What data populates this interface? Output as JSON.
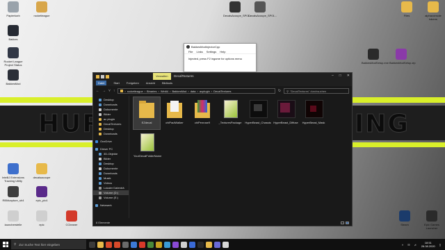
{
  "desktop": {
    "banner_left": "HURR",
    "banner_right": "DING",
    "icons": [
      {
        "id": "papierkorb",
        "label": "Papierkorb",
        "color": "#9aa3ab"
      },
      {
        "id": "rocketleague",
        "label": "rocketleague",
        "color": "#d8a64a"
      },
      {
        "id": "bakkes",
        "label": "Bakkes",
        "color": "#262a33"
      },
      {
        "id": "rl-tracker",
        "label": "Rocket League Project Status",
        "color": "#323846"
      },
      {
        "id": "bakkesmod",
        "label": "BakkesMod",
        "color": "#2b2f38"
      },
      {
        "id": "decal-1",
        "label": "DecalsAcoupe_SP01...",
        "color": "#333"
      },
      {
        "id": "decal-2",
        "label": "DecalsAcoupe_SP01...",
        "color": "#555"
      },
      {
        "id": "files",
        "label": "Files",
        "color": "#e7b94a"
      },
      {
        "id": "alphaconsole",
        "label": "alphaconsole tokens",
        "color": "#e7b94a"
      },
      {
        "id": "bakkesmodsetup",
        "label": "BakkesModSetup.exe",
        "color": "#2a2a2a"
      },
      {
        "id": "bakkesmodsetup-zip",
        "label": "BakkesModSetup.zip",
        "color": "#8a3aa8"
      },
      {
        "id": "intellij",
        "label": "IntelliJ Extensions Tracking Utility",
        "color": "#3d6fcc"
      },
      {
        "id": "decalsacoupe",
        "label": "decalsacoupe",
        "color": "#e7b94a"
      },
      {
        "id": "rl-unknown",
        "label": "RBMcapture_sh4",
        "color": "#3d3d3d"
      },
      {
        "id": "epic-x",
        "label": "epic_pic4",
        "color": "#5a2a8a"
      },
      {
        "id": "launcher",
        "label": "launcherstelle",
        "color": "#cfcfcf"
      },
      {
        "id": "epic",
        "label": "epic",
        "color": "#cfcfcf"
      },
      {
        "id": "ccleaner",
        "label": "CCleaner",
        "color": "#d33a2a"
      },
      {
        "id": "steam",
        "label": "Steam",
        "color": "#1b3b6b"
      },
      {
        "id": "epic-games",
        "label": "Epic Games Launcher",
        "color": "#2a2a2a"
      }
    ]
  },
  "dialog": {
    "title": "BakkesModInjectorCpp",
    "menu": [
      "File",
      "Links",
      "Settings",
      "Help"
    ],
    "message": "Injected, press F2 ingame for options menu"
  },
  "explorer": {
    "context_tab": "Verwalten",
    "window_title": "DecalTextures",
    "ribbon_tabs": [
      "Datei",
      "Start",
      "Freigeben",
      "Ansicht",
      "Bildtools"
    ],
    "breadcrumb": [
      "rocketleague",
      "Binaries",
      "Win64",
      "BakkesMod",
      "data",
      "acplugin",
      "DecalTextures"
    ],
    "search_placeholder": "\"DecalTextures\" durchsuchen",
    "nav": [
      {
        "label": "Desktop",
        "color": "#5b9bd5",
        "selected": false,
        "indent": 1
      },
      {
        "label": "Downloads",
        "color": "#5b9bd5",
        "selected": false,
        "indent": 1
      },
      {
        "label": "Dokumente",
        "color": "#cfcfcf",
        "selected": false,
        "indent": 1
      },
      {
        "label": "Bilder",
        "color": "#cfcfcf",
        "selected": false,
        "indent": 1
      },
      {
        "label": "ac plugin",
        "color": "#e7b94a",
        "selected": false,
        "indent": 1
      },
      {
        "label": "DecalTextures",
        "color": "#e7b94a",
        "selected": false,
        "indent": 1
      },
      {
        "label": "Desktop",
        "color": "#e7b94a",
        "selected": false,
        "indent": 1
      },
      {
        "label": "Downloads",
        "color": "#e7b94a",
        "selected": false,
        "indent": 1
      },
      {
        "label": "",
        "color": "",
        "gap": true
      },
      {
        "label": "OneDrive",
        "color": "#3d8be0",
        "selected": false,
        "indent": 0
      },
      {
        "label": "",
        "color": "",
        "gap": true
      },
      {
        "label": "Dieser PC",
        "color": "#5b9bd5",
        "selected": false,
        "indent": 0
      },
      {
        "label": "3D-Objekte",
        "color": "#5b9bd5",
        "selected": false,
        "indent": 1
      },
      {
        "label": "Bilder",
        "color": "#cfcfcf",
        "selected": false,
        "indent": 1
      },
      {
        "label": "Desktop",
        "color": "#5b9bd5",
        "selected": false,
        "indent": 1
      },
      {
        "label": "Dokumente",
        "color": "#cfcfcf",
        "selected": false,
        "indent": 1
      },
      {
        "label": "Downloads",
        "color": "#5b9bd5",
        "selected": false,
        "indent": 1
      },
      {
        "label": "Musik",
        "color": "#5b9bd5",
        "selected": false,
        "indent": 1
      },
      {
        "label": "Videos",
        "color": "#5b9bd5",
        "selected": false,
        "indent": 1
      },
      {
        "label": "Lokaler Datenträ",
        "color": "#9a9a9a",
        "selected": false,
        "indent": 1
      },
      {
        "label": "Volume (D:)",
        "color": "#9a9a9a",
        "selected": true,
        "indent": 1
      },
      {
        "label": "Volume (E:)",
        "color": "#9a9a9a",
        "selected": false,
        "indent": 1
      },
      {
        "label": "",
        "color": "",
        "gap": true
      },
      {
        "label": "Netzwerk",
        "color": "#5b9bd5",
        "selected": false,
        "indent": 0
      }
    ],
    "files": [
      {
        "name": "EZdecal",
        "kind": "folder",
        "selected": true
      },
      {
        "name": "chiPaulWalker",
        "kind": "folder-doc",
        "selected": false
      },
      {
        "name": "chiPenrose9",
        "kind": "folder-color",
        "selected": false
      },
      {
        "name": "_TexturesPackage",
        "kind": "pack",
        "selected": false
      },
      {
        "name": "HyperBeast_Chassis",
        "kind": "dark",
        "selected": false
      },
      {
        "name": "HyperBeast_Diffuse",
        "kind": "dark2",
        "selected": false
      },
      {
        "name": "HyperBeast_Mask",
        "kind": "dark3",
        "selected": false
      },
      {
        "name": "YourDecalFolderName",
        "kind": "pack",
        "selected": false
      }
    ],
    "status": "8 Elemente"
  },
  "taskbar": {
    "search_placeholder": "Zur Suche Text hier eingeben",
    "apps": [
      "#3a3a3a",
      "#e7b94a",
      "#d84a2a",
      "#d84a2a",
      "#6a6a6a",
      "#3c7ad6",
      "#d83a2a",
      "#4a8a3a",
      "#c8a020",
      "#3a9ad6",
      "#8a4ad6",
      "#cfcfcf",
      "#3a6ad6",
      "#2a2a2a",
      "#e7b94a",
      "#6a6ad6",
      "#d8d8d8"
    ],
    "time": "18:51",
    "date": "26.08.2020"
  }
}
